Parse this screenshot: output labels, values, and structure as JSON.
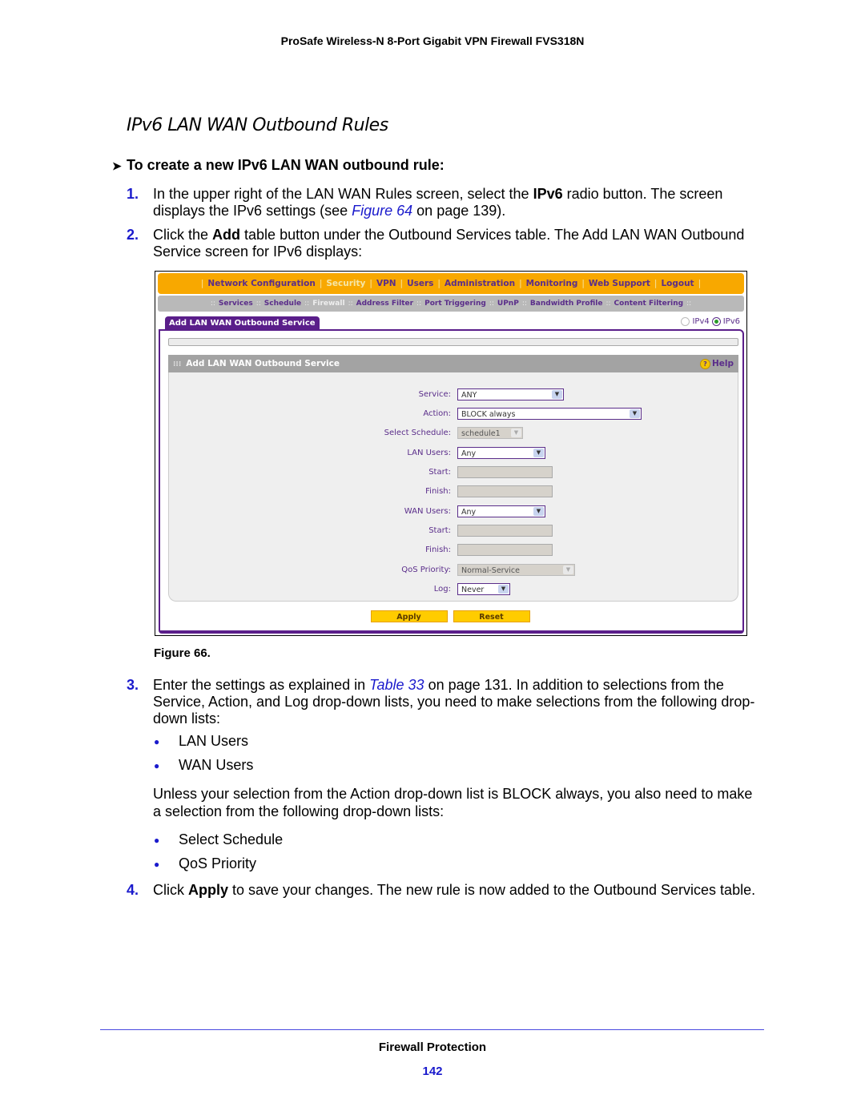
{
  "header": {
    "product": "ProSafe Wireless-N 8-Port Gigabit VPN Firewall FVS318N"
  },
  "section_title": "IPv6 LAN WAN Outbound Rules",
  "procedure": {
    "arrow_icon": "➤",
    "heading": "To create a new IPv6 LAN WAN outbound rule:",
    "steps": [
      {
        "num": "1.",
        "parts": [
          "In the upper right of the LAN WAN Rules screen, select the ",
          "IPv6",
          " radio button. The screen displays the IPv6 settings (see ",
          "Figure 64",
          " on page 139)."
        ]
      },
      {
        "num": "2.",
        "parts": [
          "Click the ",
          "Add",
          " table button under the Outbound Services table. The Add LAN WAN Outbound Service screen for IPv6 displays:"
        ]
      },
      {
        "num": "3.",
        "parts": [
          "Enter the settings as explained in ",
          "Table 33",
          " on page 131. In addition to selections from the Service, Action, and Log drop-down lists, you need to make selections from the following drop-down lists:"
        ],
        "bullets": [
          "LAN Users",
          "WAN Users"
        ],
        "followup": "Unless your selection from the Action drop-down list is BLOCK always, you also need to make a selection from the following drop-down lists:",
        "bullets2": [
          "Select Schedule",
          "QoS Priority"
        ]
      },
      {
        "num": "4.",
        "parts": [
          "Click ",
          "Apply",
          " to save your changes. The new rule is now added to the Outbound Services table."
        ]
      }
    ]
  },
  "figure": {
    "caption": "Figure 66.",
    "top_nav": [
      "Network Configuration",
      "Security",
      "VPN",
      "Users",
      "Administration",
      "Monitoring",
      "Web Support",
      "Logout"
    ],
    "top_nav_active": "Security",
    "sub_nav": [
      "Services",
      "Schedule",
      "Firewall",
      "Address Filter",
      "Port Triggering",
      "UPnP",
      "Bandwidth Profile",
      "Content Filtering"
    ],
    "sub_nav_active": "Firewall",
    "panel_tab": "Add LAN WAN Outbound Service",
    "ip_options": {
      "ipv4": "IPv4",
      "ipv6": "IPv6",
      "selected": "IPv6"
    },
    "section_header": "Add LAN WAN Outbound Service",
    "help_label": "Help",
    "fields": {
      "service": {
        "label": "Service:",
        "value": "ANY"
      },
      "action": {
        "label": "Action:",
        "value": "BLOCK always"
      },
      "schedule": {
        "label": "Select Schedule:",
        "value": "schedule1"
      },
      "lan_users": {
        "label": "LAN Users:",
        "value": "Any"
      },
      "lan_start": {
        "label": "Start:",
        "value": ""
      },
      "lan_finish": {
        "label": "Finish:",
        "value": ""
      },
      "wan_users": {
        "label": "WAN Users:",
        "value": "Any"
      },
      "wan_start": {
        "label": "Start:",
        "value": ""
      },
      "wan_finish": {
        "label": "Finish:",
        "value": ""
      },
      "qos": {
        "label": "QoS Priority:",
        "value": "Normal-Service"
      },
      "log": {
        "label": "Log:",
        "value": "Never"
      }
    },
    "buttons": {
      "apply": "Apply",
      "reset": "Reset"
    }
  },
  "footer": {
    "title": "Firewall Protection",
    "page": "142"
  }
}
